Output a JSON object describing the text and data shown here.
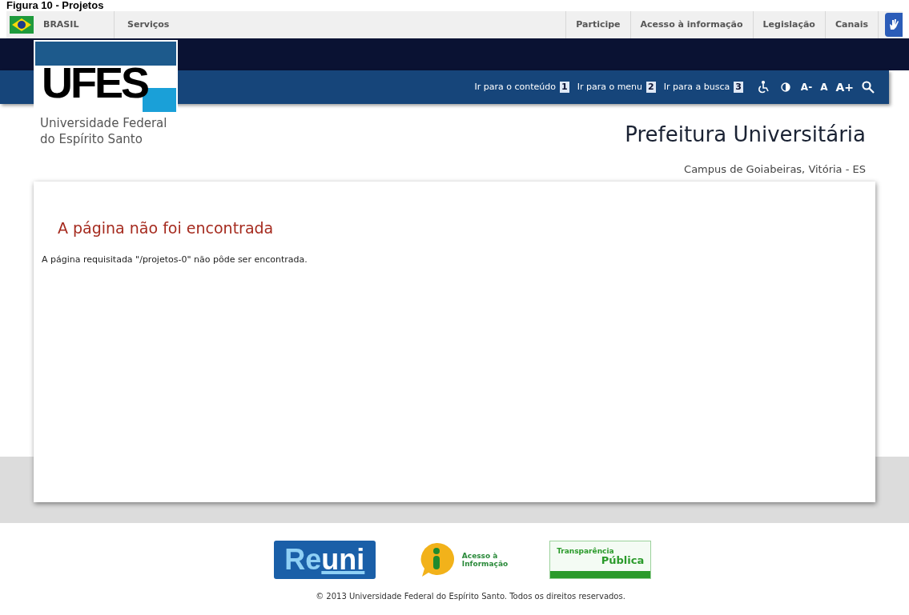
{
  "caption": "Figura 10 - Projetos",
  "gov_bar": {
    "country": "BRASIL",
    "left_links": [
      "Serviços"
    ],
    "right_links": [
      "Participe",
      "Acesso à informação",
      "Legislação",
      "Canais"
    ]
  },
  "logo": {
    "mark": "UFES",
    "name_lines": [
      "Universidade Federal",
      "do Espírito Santo"
    ]
  },
  "accessibility_bar": {
    "shortcuts": [
      {
        "label": "Ir para o conteúdo",
        "key": "1"
      },
      {
        "label": "Ir para o menu",
        "key": "2"
      },
      {
        "label": "Ir para a busca",
        "key": "3"
      }
    ],
    "font_sizes": [
      "A-",
      "A",
      "A+"
    ]
  },
  "site": {
    "title": "Prefeitura Universitária",
    "subtitle": "Campus de Goiabeiras, Vitória - ES"
  },
  "content": {
    "heading": "A página não foi encontrada",
    "message": "A página requisitada \"/projetos-0\" não pôde ser encontrada."
  },
  "footer": {
    "logos": [
      {
        "kind": "reuni",
        "parts": [
          "Re",
          "uni"
        ]
      },
      {
        "kind": "info",
        "lines": [
          "Acesso à",
          "Informação"
        ]
      },
      {
        "kind": "transparency",
        "lines": [
          "Transparência",
          "Pública"
        ]
      }
    ],
    "copyright": "© 2013 Universidade Federal do Espírito Santo. Todos os direitos reservados."
  }
}
